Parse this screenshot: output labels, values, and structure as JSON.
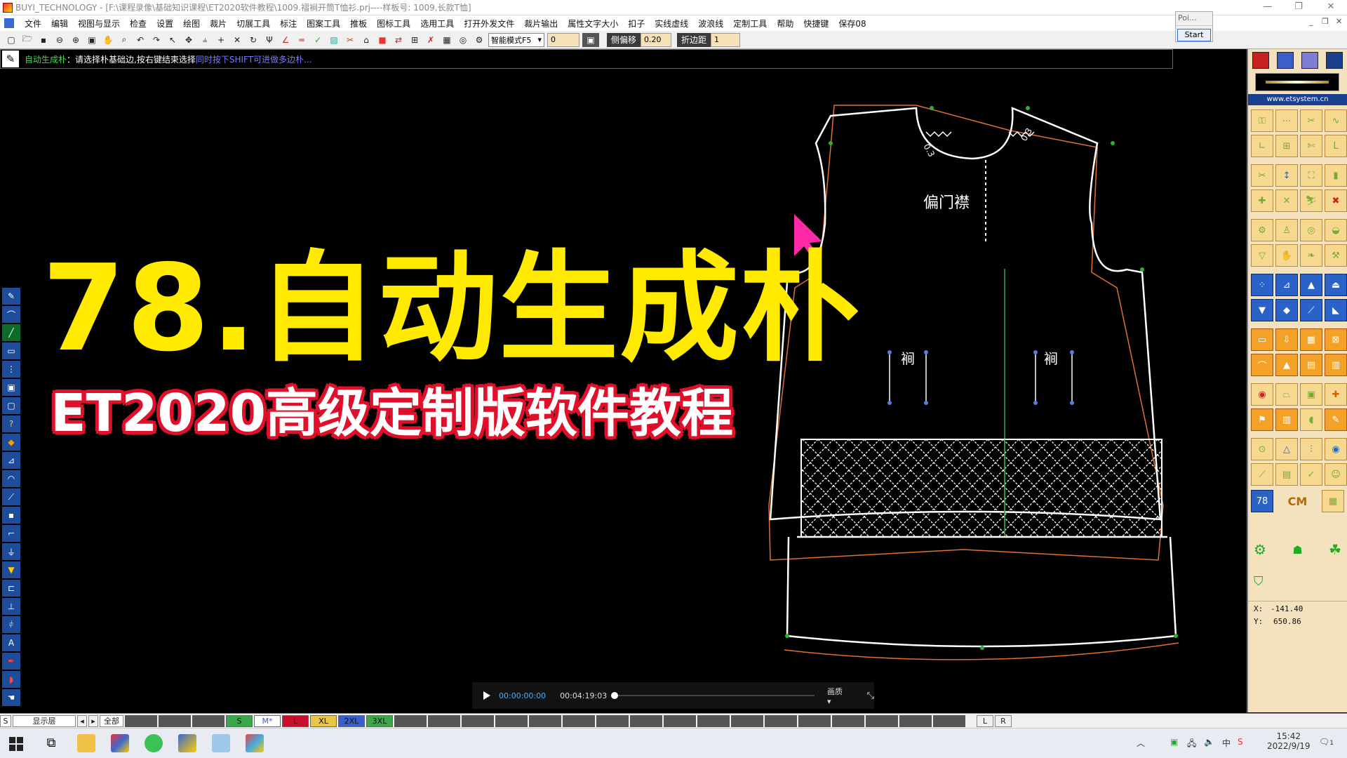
{
  "window": {
    "title": "BUYI_TECHNOLOGY - [F:\\课程录像\\基础知识课程\\ET2020软件教程\\1009.褶裥开筒T恤衫.prj----样板号: 1009,长款T恤]",
    "minimize": "—",
    "maximize": "❐",
    "close": "✕"
  },
  "menu": {
    "items": [
      "文件",
      "编辑",
      "视图与显示",
      "检查",
      "设置",
      "绘图",
      "裁片",
      "切展工具",
      "标注",
      "图案工具",
      "推板",
      "图标工具",
      "选用工具",
      "打开外发文件",
      "裁片输出",
      "属性文字大小",
      "扣子",
      "实线虚线",
      "波浪线",
      "定制工具",
      "帮助",
      "快捷键",
      "保存08"
    ],
    "mdi_min": "_",
    "mdi_restore": "❐",
    "mdi_close": "✕"
  },
  "toolbar": {
    "mode_select": "智能模式F5",
    "value1": "0",
    "offset_label": "侧偏移",
    "offset_value": "0.20",
    "fold_label": "折边距",
    "fold_value": "1"
  },
  "popup": {
    "title": "Poi...",
    "start": "Start"
  },
  "prompt": {
    "tool": "自动生成朴",
    "text": "：请选择朴基础边,按右键结束选择",
    "hint": "同时按下SHIFT可进做多边朴..."
  },
  "overlay": {
    "title": "78.自动生成朴",
    "subtitle": "ET2020高级定制版软件教程"
  },
  "pattern": {
    "placket_label": "偏门襟",
    "pocket_left": "裥",
    "pocket_right": "裥",
    "neck_left_label": "0.3",
    "neck_right_label": "0.3"
  },
  "video": {
    "current": "00:00:00:00",
    "total": "00:04:19:03",
    "quality": "画质"
  },
  "rightpanel": {
    "url": "www.etsystem.cn",
    "unit": "CM",
    "x_label": "X:",
    "x_value": "-141.40",
    "y_label": "Y:",
    "y_value": "650.86",
    "counter": "78"
  },
  "sizebar": {
    "s_label": "S",
    "layer_label": "显示层",
    "all_label": "全部",
    "sizes": [
      {
        "name": "S",
        "color": "#3aa84a"
      },
      {
        "name": "M*",
        "color": "#ffffff"
      },
      {
        "name": "L",
        "color": "#c8102e"
      },
      {
        "name": "XL",
        "color": "#e8c64a"
      },
      {
        "name": "2XL",
        "color": "#3b5ec8"
      },
      {
        "name": "3XL",
        "color": "#3aa84a"
      }
    ],
    "left_btn": "L",
    "right_btn": "R"
  },
  "taskbar": {
    "time": "15:42",
    "date": "2022/9/19",
    "lang": "中",
    "notif": "1"
  },
  "colors": {
    "yellow_title": "#ffea00",
    "subtitle_outline": "#e0102a",
    "cursor": "#ff2aa8",
    "pattern_outline": "#ffffff",
    "seam_line": "#e07030",
    "grain_line": "#2fae3f"
  }
}
